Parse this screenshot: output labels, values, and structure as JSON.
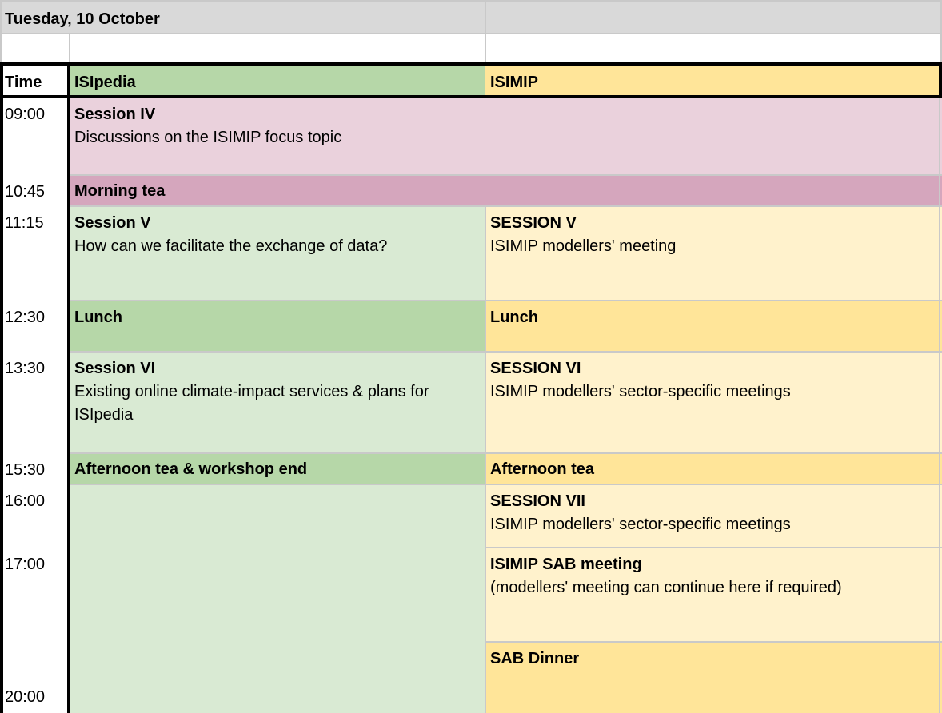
{
  "date_header": "Tuesday, 10 October",
  "columns": {
    "time": "Time",
    "isipedia": "ISIpedia",
    "isimip": "ISIMIP"
  },
  "times": [
    "09:00",
    "10:45",
    "11:15",
    "12:30",
    "13:30",
    "15:30",
    "16:00",
    "17:00",
    "20:00"
  ],
  "colors": {
    "header_gray": "#d9d9d9",
    "green_dark": "#b6d7a8",
    "green_light": "#d9ead3",
    "yellow_dark": "#ffe599",
    "yellow_light": "#fff2cc",
    "pink_light": "#ead1dc",
    "pink_dark": "#d5a6bd"
  },
  "schedule": {
    "session_iv": {
      "title": "Session IV",
      "desc": "Discussions on the ISIMIP focus topic"
    },
    "morning_tea": "Morning tea",
    "isipedia_session_v": {
      "title": "Session V",
      "desc": "How can we facilitate the exchange of data?"
    },
    "isimip_session_v": {
      "title": "SESSION V",
      "desc": "ISIMIP modellers' meeting"
    },
    "lunch_isipedia": "Lunch",
    "lunch_isimip": "Lunch",
    "isipedia_session_vi": {
      "title": "Session VI",
      "desc_line1": "Existing online climate-impact services & plans for",
      "desc_line2": "ISIpedia"
    },
    "isimip_session_vi": {
      "title": "SESSION VI",
      "desc": "ISIMIP modellers' sector-specific meetings"
    },
    "afternoon_tea_isipedia": "Afternoon tea & workshop end",
    "afternoon_tea_isimip": "Afternoon tea",
    "isimip_session_vii": {
      "title": "SESSION VII",
      "desc": "ISIMIP modellers' sector-specific meetings"
    },
    "sab_meeting": {
      "title": "ISIMIP SAB meeting",
      "desc": "(modellers' meeting can continue here if required)"
    },
    "sab_dinner": "SAB Dinner"
  }
}
